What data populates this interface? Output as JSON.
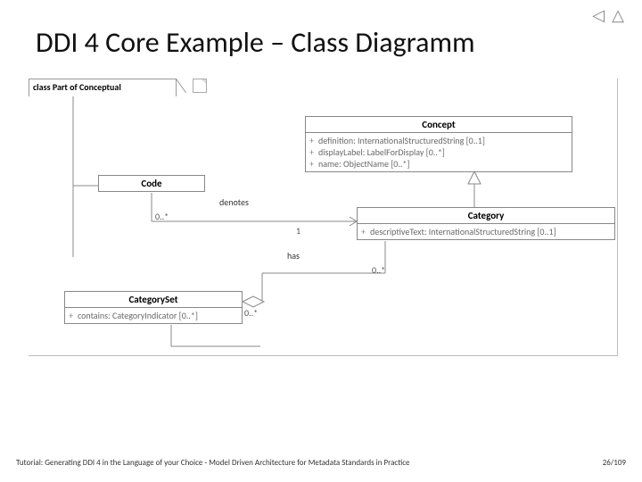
{
  "nav": {
    "prev_glyph": "◁",
    "next_glyph": "△"
  },
  "title": "DDI 4 Core Example – Class Diagramm",
  "package_label": "class Part of Conceptual",
  "classes": {
    "concept": {
      "name": "Concept",
      "attrs": [
        "definition: InternationalStructuredString [0..1]",
        "displayLabel: LabelForDisplay [0..*]",
        "name: ObjectName [0..*]"
      ]
    },
    "code": {
      "name": "Code"
    },
    "category": {
      "name": "Category",
      "attrs": [
        "descriptiveText: InternationalStructuredString [0..1]"
      ]
    },
    "categorySet": {
      "name": "CategorySet",
      "attrs": [
        "contains: CategoryIndicator [0..*]"
      ]
    }
  },
  "assoc": {
    "denotes": {
      "label": "denotes",
      "end1": "0..*",
      "end2": "1"
    },
    "has": {
      "label": "has",
      "end2": "0..*"
    },
    "contains_end": "0..*"
  },
  "footer": {
    "left": "Tutorial: Generating DDI 4 in the Language of your Choice  -  Model Driven Architecture for Metadata Standards in Practice",
    "right": "26/109"
  }
}
